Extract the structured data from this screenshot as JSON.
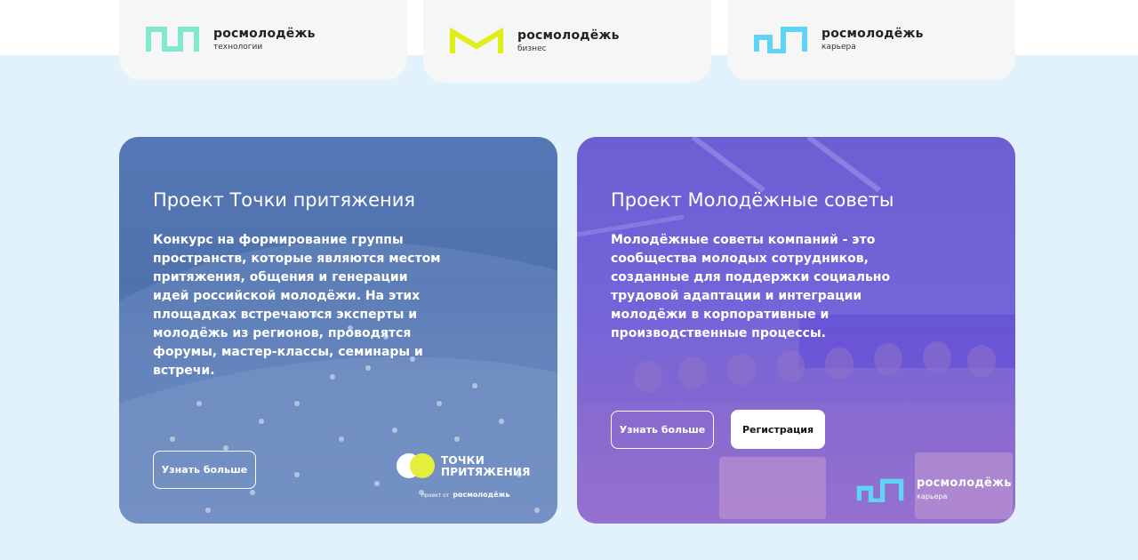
{
  "brands": [
    {
      "name": "росмолодёжь",
      "sub": "технологии",
      "icon": "tech-wave-logo-icon",
      "color": "#7fe8cd"
    },
    {
      "name": "росмолодёжь",
      "sub": "бизнес",
      "icon": "business-m-logo-icon",
      "color": "#dfee1a"
    },
    {
      "name": "росмолодёжь",
      "sub": "карьера",
      "icon": "career-wave-logo-icon",
      "color": "#5fd4f4"
    }
  ],
  "projects": [
    {
      "title": "Проект Точки притяжения",
      "description": "Конкурс на формирование группы пространств, которые являются местом притяжения, общения и генерации идей российской молодёжи. На этих площадках встречаются эксперты и молодёжь из регионов, проводятся форумы, мастер-классы, семинары и встречи.",
      "more_label": "Узнать больше",
      "logo_line1": "ТОЧКИ",
      "logo_line2": "ПРИТЯЖЕНИЯ",
      "credit_prefix": "проект от",
      "credit_name": "росмолодёжь"
    },
    {
      "title": "Проект Молодёжные советы",
      "description": "Молодёжные советы компаний - это сообщества молодых сотрудников, созданные для поддержки социально трудовой адаптации и интеграции молодёжи в корпоративные и производственные процессы.",
      "more_label": "Узнать больше",
      "register_label": "Регистрация",
      "logo_name": "росмолодёжь",
      "logo_sub": "карьера"
    }
  ],
  "colors": {
    "band": "#e2f2fd",
    "card_blue": "#5577b5",
    "card_purple": "#7464d9",
    "accent_yellow": "#e3ef3a"
  }
}
